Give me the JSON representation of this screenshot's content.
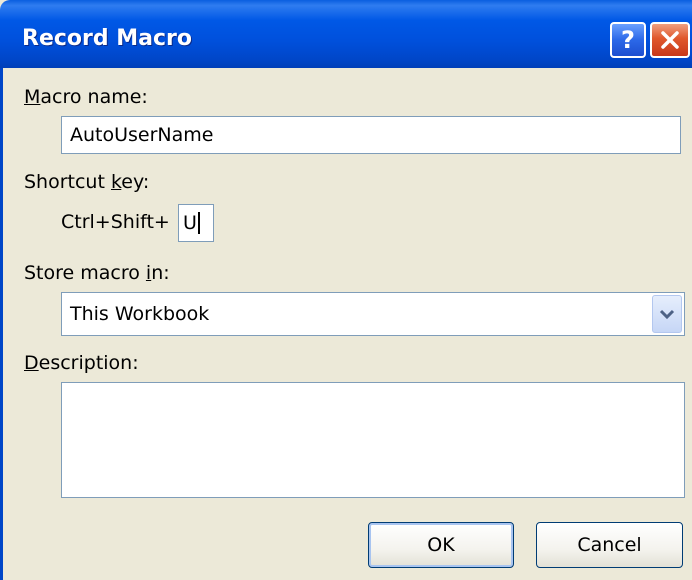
{
  "window": {
    "title": "Record Macro"
  },
  "titlebar": {
    "help_label": "?",
    "help_icon": "question-mark-icon",
    "close_icon": "close-x-icon"
  },
  "form": {
    "macro_name": {
      "label_underlined": "M",
      "label_rest": "acro name:",
      "value": "AutoUserName"
    },
    "shortcut_key": {
      "label_start": "Shortcut ",
      "label_underlined": "k",
      "label_end": "ey:",
      "prefix": "Ctrl+Shift+",
      "value": "U"
    },
    "store_macro_in": {
      "label_start": "Store macro ",
      "label_underlined": "i",
      "label_end": "n:",
      "selected": "This Workbook",
      "arrow_icon": "chevron-down-icon"
    },
    "description": {
      "label_underlined": "D",
      "label_rest": "escription:",
      "value": ""
    }
  },
  "buttons": {
    "ok": "OK",
    "cancel": "Cancel"
  },
  "colors": {
    "titlebar": "#0054e3",
    "close_button": "#e0582c",
    "dialog_bg": "#ece9d8",
    "field_border": "#7f9db9"
  }
}
